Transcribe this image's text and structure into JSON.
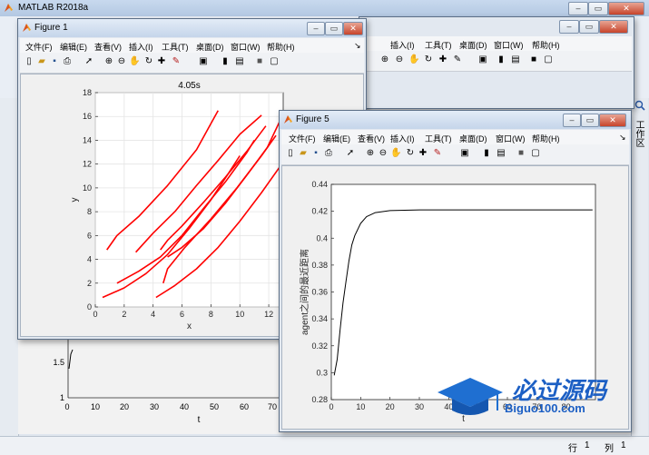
{
  "main_window": {
    "title": "MATLAB R2018a",
    "status_row_label": "行",
    "status_row_value": "1",
    "status_col_label": "列",
    "status_col_value": "1",
    "side_tab_label": "工作区"
  },
  "background_plot": {
    "x_ticks": [
      "0",
      "10",
      "20",
      "30",
      "40",
      "50",
      "60",
      "70"
    ],
    "y_ticks": [
      "1",
      "1.5"
    ],
    "xlabel": "t"
  },
  "figure1": {
    "title": "Figure 1",
    "menus": [
      "文件(F)",
      "编辑(E)",
      "查看(V)",
      "插入(I)",
      "工具(T)",
      "桌面(D)",
      "窗口(W)",
      "帮助(H)"
    ],
    "plot_title": "4.05s"
  },
  "figure5": {
    "title": "Figure 5",
    "menus": [
      "文件(F)",
      "编辑(E)",
      "查看(V)",
      "插入(I)",
      "工具(T)",
      "桌面(D)",
      "窗口(W)",
      "帮助(H)"
    ]
  },
  "toolbar_icons": [
    "new-file-icon",
    "open-icon",
    "save-icon",
    "print-icon",
    "pointer-icon",
    "zoom-in-icon",
    "zoom-out-icon",
    "pan-icon",
    "rotate-icon",
    "data-cursor-icon",
    "brush-icon",
    "link-icon",
    "colorbar-icon",
    "legend-icon",
    "hide-icon",
    "show-plot-tools-icon"
  ],
  "chart_data": [
    {
      "type": "line",
      "title": "4.05s",
      "xlabel": "x",
      "ylabel": "y",
      "xlim": [
        0,
        13
      ],
      "ylim": [
        0,
        18
      ],
      "x_ticks": [
        0,
        2,
        4,
        6,
        8,
        10,
        12
      ],
      "y_ticks": [
        0,
        2,
        4,
        6,
        8,
        10,
        12,
        14,
        16,
        18
      ],
      "grid": true,
      "color": "#ff0000",
      "series": [
        {
          "x": [
            0.8,
            1.5,
            3,
            5,
            7,
            8.5
          ],
          "y": [
            4.8,
            6,
            7.6,
            10.2,
            13.2,
            16.5
          ]
        },
        {
          "x": [
            0.5,
            2,
            3.5,
            5,
            6.5,
            8,
            9.2,
            10
          ],
          "y": [
            0.8,
            1.6,
            2.8,
            4.4,
            6.6,
            9,
            11.2,
            12.7
          ]
        },
        {
          "x": [
            1.5,
            3,
            4.5,
            6,
            7.5,
            9,
            10.5,
            11
          ],
          "y": [
            2,
            3,
            4.2,
            6,
            8.3,
            10.5,
            13,
            14
          ]
        },
        {
          "x": [
            2.8,
            4,
            5.5,
            7,
            8.5,
            10,
            11.5
          ],
          "y": [
            4.6,
            6.2,
            8,
            10.2,
            12.3,
            14.5,
            16.1
          ]
        },
        {
          "x": [
            4.5,
            5,
            6,
            7.5,
            9,
            10.5,
            11.8
          ],
          "y": [
            4.8,
            5.6,
            6.8,
            8.8,
            10.9,
            13.1,
            15.2
          ]
        },
        {
          "x": [
            4.7,
            5,
            6.2,
            8,
            9.8,
            11.5,
            12.5
          ],
          "y": [
            2,
            3.2,
            5,
            7.4,
            10,
            12.7,
            14.4
          ]
        },
        {
          "x": [
            4.2,
            5.5,
            7,
            8.5,
            10,
            11.5,
            12.9
          ],
          "y": [
            0.8,
            1.8,
            3.2,
            5,
            7.2,
            9.6,
            12
          ]
        },
        {
          "x": [
            5,
            6,
            7.5,
            9,
            10.5,
            11.9,
            13
          ],
          "y": [
            4.2,
            5,
            6.6,
            8.7,
            11.1,
            13.4,
            16.2
          ]
        }
      ]
    },
    {
      "type": "line",
      "xlabel": "t",
      "ylabel": "agent之间的最近距离",
      "xlim": [
        0,
        90
      ],
      "ylim": [
        0.28,
        0.44
      ],
      "x_ticks": [
        0,
        10,
        20,
        30,
        40,
        50,
        60,
        70,
        80
      ],
      "y_ticks": [
        0.28,
        0.3,
        0.32,
        0.34,
        0.36,
        0.38,
        0.4,
        0.42,
        0.44
      ],
      "grid": false,
      "color": "#000000",
      "series": [
        {
          "x": [
            1,
            2,
            3,
            4,
            5,
            6,
            7,
            8,
            10,
            12,
            15,
            20,
            30,
            40,
            60,
            80,
            89
          ],
          "y": [
            0.298,
            0.31,
            0.332,
            0.352,
            0.368,
            0.383,
            0.395,
            0.402,
            0.411,
            0.416,
            0.419,
            0.4205,
            0.421,
            0.421,
            0.421,
            0.421,
            0.421
          ]
        }
      ]
    }
  ],
  "watermark": {
    "brand": "必过源码",
    "url": "Biguo100.com"
  }
}
